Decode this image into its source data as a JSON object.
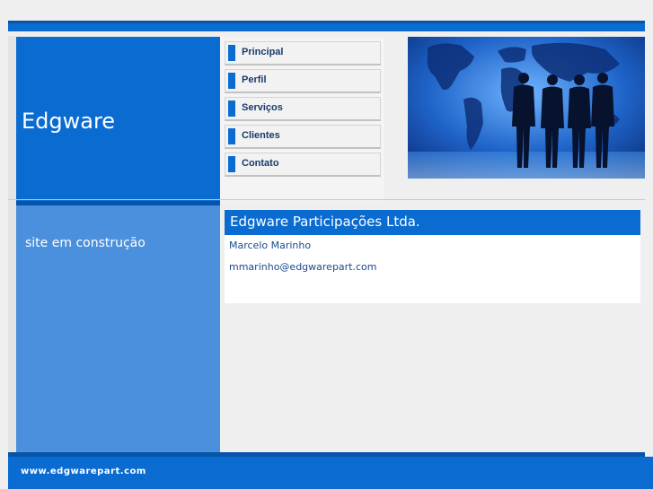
{
  "brand": {
    "title": "Edgware",
    "tagline": "site em construção"
  },
  "nav": {
    "items": [
      {
        "label": "Principal"
      },
      {
        "label": "Perfil"
      },
      {
        "label": "Serviços"
      },
      {
        "label": "Clientes"
      },
      {
        "label": "Contato"
      }
    ]
  },
  "content": {
    "title": "Edgware Participações Ltda.",
    "contact_name": "Marcelo Marinho",
    "contact_email": "mmarinho@edgwarepart.com"
  },
  "footer": {
    "url": "www.edgwarepart.com"
  },
  "colors": {
    "primary": "#0a6bd1",
    "primary_dark": "#0754a8",
    "sidebar_light": "#4a90dc",
    "link_text": "#1a4a8a"
  }
}
